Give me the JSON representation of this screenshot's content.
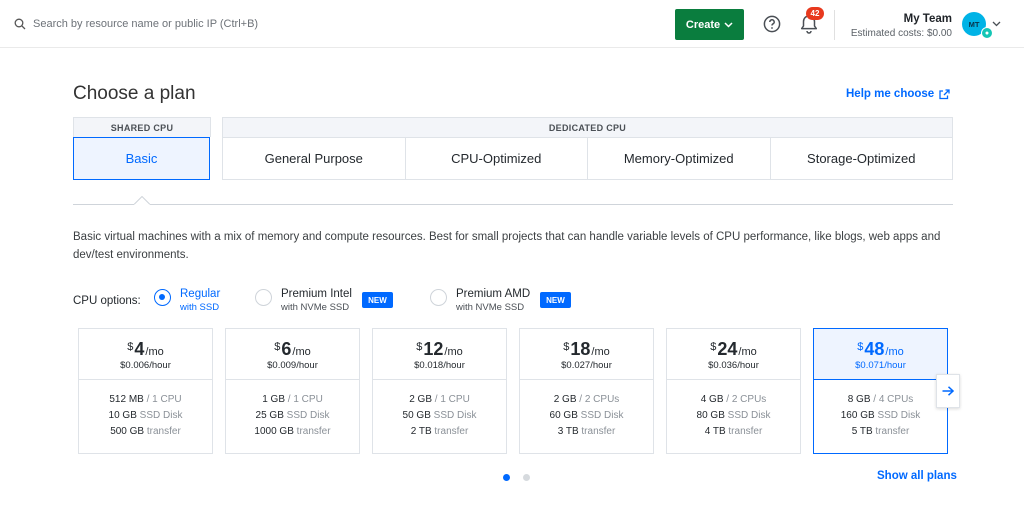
{
  "topbar": {
    "search_placeholder": "Search by resource name or public IP (Ctrl+B)",
    "create_label": "Create",
    "notification_count": "42",
    "team_name": "My Team",
    "estimated_costs": "Estimated costs: $0.00",
    "avatar_initials": "MT"
  },
  "header": {
    "title": "Choose a plan",
    "help_link": "Help me choose"
  },
  "plan_groups": {
    "shared_label": "SHARED CPU",
    "dedicated_label": "DEDICATED CPU",
    "shared_tabs": [
      "Basic"
    ],
    "dedicated_tabs": [
      "General Purpose",
      "CPU-Optimized",
      "Memory-Optimized",
      "Storage-Optimized"
    ],
    "selected_tab": "Basic"
  },
  "description": "Basic virtual machines with a mix of memory and compute resources. Best for small projects that can handle variable levels of CPU performance, like blogs, web apps and dev/test environments.",
  "cpu_options": {
    "label": "CPU options:",
    "options": [
      {
        "main": "Regular",
        "sub": "with SSD",
        "selected": true,
        "badge": ""
      },
      {
        "main": "Premium Intel",
        "sub": "with NVMe SSD",
        "selected": false,
        "badge": "NEW"
      },
      {
        "main": "Premium AMD",
        "sub": "with NVMe SSD",
        "selected": false,
        "badge": "NEW"
      }
    ]
  },
  "plans": [
    {
      "currency": "$",
      "price": "4",
      "per": "/mo",
      "hourly": "$0.006",
      "hourly_unit": "/hour",
      "memory": "512 MB",
      "cpu": "1 CPU",
      "disk": "10 GB",
      "disk_label": "SSD Disk",
      "transfer": "500 GB",
      "transfer_label": "transfer"
    },
    {
      "currency": "$",
      "price": "6",
      "per": "/mo",
      "hourly": "$0.009",
      "hourly_unit": "/hour",
      "memory": "1 GB",
      "cpu": "1 CPU",
      "disk": "25 GB",
      "disk_label": "SSD Disk",
      "transfer": "1000 GB",
      "transfer_label": "transfer"
    },
    {
      "currency": "$",
      "price": "12",
      "per": "/mo",
      "hourly": "$0.018",
      "hourly_unit": "/hour",
      "memory": "2 GB",
      "cpu": "1 CPU",
      "disk": "50 GB",
      "disk_label": "SSD Disk",
      "transfer": "2 TB",
      "transfer_label": "transfer"
    },
    {
      "currency": "$",
      "price": "18",
      "per": "/mo",
      "hourly": "$0.027",
      "hourly_unit": "/hour",
      "memory": "2 GB",
      "cpu": "2 CPUs",
      "disk": "60 GB",
      "disk_label": "SSD Disk",
      "transfer": "3 TB",
      "transfer_label": "transfer"
    },
    {
      "currency": "$",
      "price": "24",
      "per": "/mo",
      "hourly": "$0.036",
      "hourly_unit": "/hour",
      "memory": "4 GB",
      "cpu": "2 CPUs",
      "disk": "80 GB",
      "disk_label": "SSD Disk",
      "transfer": "4 TB",
      "transfer_label": "transfer"
    },
    {
      "currency": "$",
      "price": "48",
      "per": "/mo",
      "hourly": "$0.071",
      "hourly_unit": "/hour",
      "memory": "8 GB",
      "cpu": "4 CPUs",
      "disk": "160 GB",
      "disk_label": "SSD Disk",
      "transfer": "5 TB",
      "transfer_label": "transfer"
    }
  ],
  "footer": {
    "show_all": "Show all plans"
  },
  "colors": {
    "accent": "#0069ff",
    "create_green": "#0a7d3e",
    "badge_red": "#e8391e"
  }
}
